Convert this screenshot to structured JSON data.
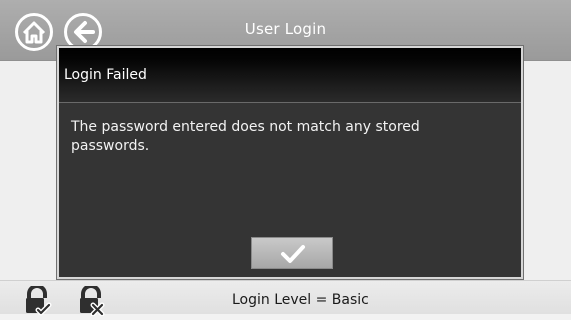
{
  "header": {
    "title": "User Login",
    "home_icon": "home-icon",
    "back_icon": "back-arrow-icon"
  },
  "dialog": {
    "title": "Login Failed",
    "message": "The password entered does not match any stored passwords.",
    "confirm_icon": "checkmark-icon"
  },
  "footer": {
    "status": "Login Level = Basic",
    "icons": [
      "lock-check-icon",
      "lock-x-icon"
    ]
  },
  "colors": {
    "header_bg": "#a5a5a5",
    "dialog_bg": "#343434",
    "button_bg": "#b8b8b8",
    "footer_bg": "#e8e8e8"
  }
}
